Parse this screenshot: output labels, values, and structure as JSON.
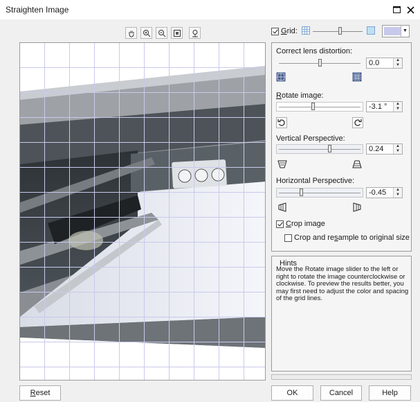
{
  "window": {
    "title": "Straighten Image",
    "maximize_icon": "maximize-icon",
    "close_icon": "close-icon"
  },
  "toolbar": {
    "tools": [
      "hand-pan-icon",
      "zoom-in-icon",
      "zoom-out-icon",
      "fit-to-window-icon",
      "actual-size-icon"
    ]
  },
  "grid": {
    "label_prefix": "",
    "label_access": "G",
    "label_rest": "rid:",
    "checked": true,
    "size_level": 0.55,
    "color": "#c9c9ec"
  },
  "lens": {
    "label": "Correct lens distortion:",
    "value": "0.0",
    "slider_level": 0.5
  },
  "rotate": {
    "label_access": "R",
    "label_rest": "otate image:",
    "value": "-3.1 °",
    "slider_level": 0.42,
    "ccw_icon": "rotate-ccw-icon",
    "cw_icon": "rotate-cw-icon"
  },
  "vertical": {
    "label": "Vertical Perspective:",
    "value": "0.24",
    "slider_level": 0.62
  },
  "horizontal": {
    "label": "Horizontal Perspective:",
    "value": "-0.45",
    "slider_level": 0.28
  },
  "crop": {
    "label_access": "C",
    "label_rest": "rop image",
    "checked": true
  },
  "resample": {
    "label_pre": "Crop and re",
    "label_access": "s",
    "label_post": "ample to original size",
    "checked": false
  },
  "hints": {
    "title": "Hints",
    "text": "Move the Rotate image slider to the left or right to rotate the image counterclockwise or clockwise. To preview the results better, you may first need to adjust the color and spacing of the grid lines."
  },
  "buttons": {
    "reset_access": "R",
    "reset_rest": "eset",
    "ok": "OK",
    "cancel": "Cancel",
    "help": "Help"
  }
}
